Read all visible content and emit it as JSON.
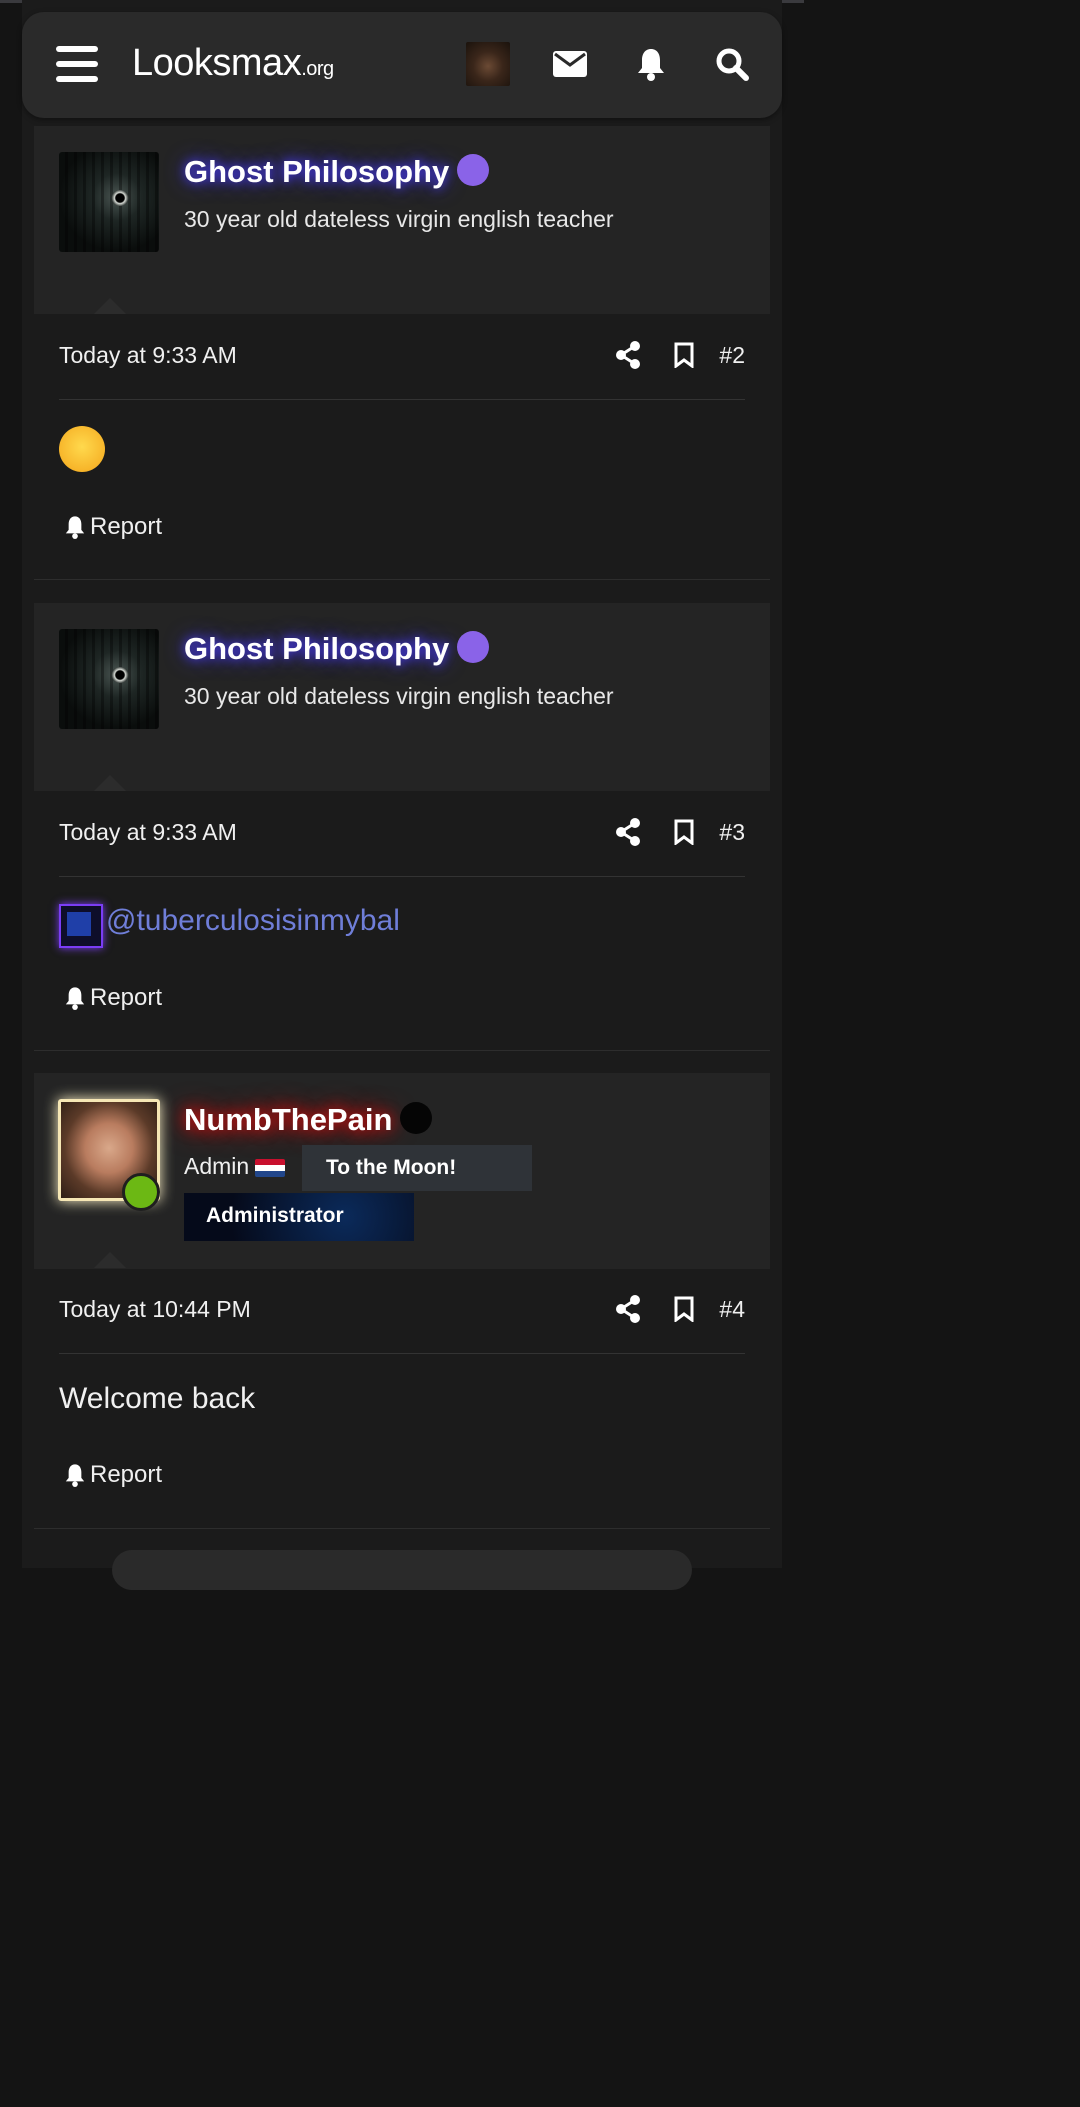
{
  "header": {
    "logo_main": "Looksmax",
    "logo_suffix": ".org",
    "icons": [
      "menu-icon",
      "avatar",
      "envelope-icon",
      "bell-icon",
      "search-icon"
    ]
  },
  "posts": [
    {
      "username": "Ghost Philosophy",
      "user_title": "30 year old dateless virgin english teacher",
      "date": "Today at 9:33 AM",
      "number": "#2",
      "content_type": "emoji",
      "emoji": "😭",
      "report_label": "Report"
    },
    {
      "username": "Ghost Philosophy",
      "user_title": "30 year old dateless virgin english teacher",
      "date": "Today at 9:33 AM",
      "number": "#3",
      "content_type": "mention",
      "mention": "@tuberculosisinmybal",
      "report_label": "Report"
    },
    {
      "username": "NumbThePain",
      "role": "Admin",
      "banner1": "To the Moon!",
      "banner2": "Administrator",
      "date": "Today at 10:44 PM",
      "number": "#4",
      "content": "Welcome back",
      "report_label": "Report"
    }
  ],
  "colors": {
    "ghost_name_glow": "#4a3df0",
    "admin_name_glow": "#e01010",
    "verified_badge": "#8a63e8",
    "mention": "#6f7ed8",
    "online": "#6cb814"
  }
}
